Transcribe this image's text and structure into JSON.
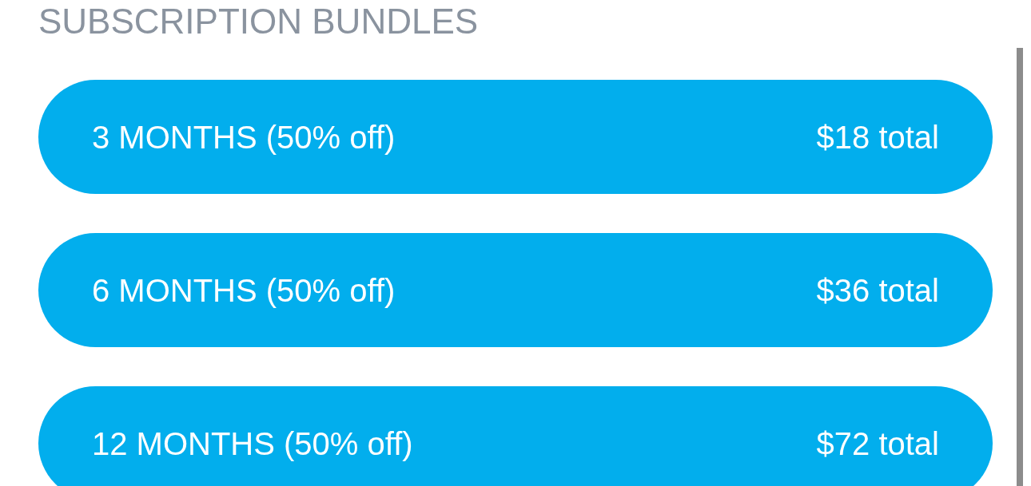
{
  "section_title": "SUBSCRIPTION BUNDLES",
  "bundles": [
    {
      "label": "3 MONTHS (50% off)",
      "price": "$18 total"
    },
    {
      "label": "6 MONTHS (50% off)",
      "price": "$36 total"
    },
    {
      "label": "12 MONTHS (50% off)",
      "price": "$72 total"
    }
  ]
}
